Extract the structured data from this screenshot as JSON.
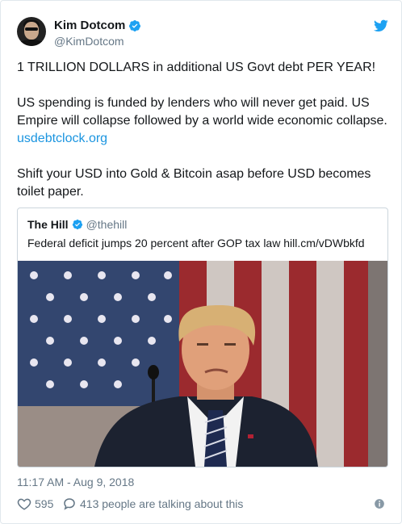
{
  "author": {
    "name": "Kim Dotcom",
    "handle": "@KimDotcom",
    "avatar_icon": "user-avatar"
  },
  "tweet": {
    "paragraphs": [
      "1 TRILLION DOLLARS in additional US Govt debt PER YEAR!",
      "US spending is funded by lenders who will never get paid. US Empire will collapse followed by a world wide economic collapse.",
      "Shift your USD into Gold & Bitcoin asap before USD becomes toilet paper."
    ],
    "link": "usdebtclock.org"
  },
  "quoted": {
    "name": "The Hill",
    "handle": "@thehill",
    "text": "Federal deficit jumps 20 percent after GOP tax law hill.cm/vDWbkfd"
  },
  "timestamp": "11:17 AM - Aug 9, 2018",
  "stats": {
    "likes": "595",
    "talking": "413 people are talking about this"
  },
  "colors": {
    "accent": "#1da1f2",
    "link": "#1b95e0",
    "secondary_text": "#657786"
  }
}
